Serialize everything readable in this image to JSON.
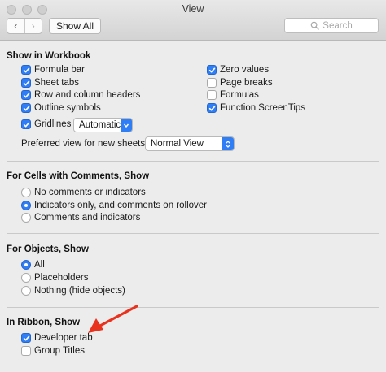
{
  "window": {
    "title": "View"
  },
  "toolbar": {
    "back_glyph": "‹",
    "forward_glyph": "›",
    "show_all_label": "Show All",
    "search_placeholder": "Search"
  },
  "workbook": {
    "title": "Show in Workbook",
    "left_options": [
      {
        "label": "Formula bar",
        "checked": true
      },
      {
        "label": "Sheet tabs",
        "checked": true
      },
      {
        "label": "Row and column headers",
        "checked": true
      },
      {
        "label": "Outline symbols",
        "checked": true
      },
      {
        "label": "Gridlines",
        "checked": true
      }
    ],
    "gridlines_color": "Automatic",
    "right_options": [
      {
        "label": "Zero values",
        "checked": true
      },
      {
        "label": "Page breaks",
        "checked": false
      },
      {
        "label": "Formulas",
        "checked": false
      },
      {
        "label": "Function ScreenTips",
        "checked": true
      }
    ],
    "preferred_view_label": "Preferred view for new sheets:",
    "preferred_view_value": "Normal View"
  },
  "comments": {
    "title": "For Cells with Comments, Show",
    "options": [
      {
        "label": "No comments or indicators",
        "selected": false
      },
      {
        "label": "Indicators only, and comments on rollover",
        "selected": true
      },
      {
        "label": "Comments and indicators",
        "selected": false
      }
    ]
  },
  "objects": {
    "title": "For Objects, Show",
    "options": [
      {
        "label": "All",
        "selected": true
      },
      {
        "label": "Placeholders",
        "selected": false
      },
      {
        "label": "Nothing (hide objects)",
        "selected": false
      }
    ]
  },
  "ribbon": {
    "title": "In Ribbon, Show",
    "options": [
      {
        "label": "Developer tab",
        "checked": true
      },
      {
        "label": "Group Titles",
        "checked": false
      }
    ]
  },
  "colors": {
    "accent": "#2f7ef6",
    "annotation_arrow": "#e8321e"
  }
}
